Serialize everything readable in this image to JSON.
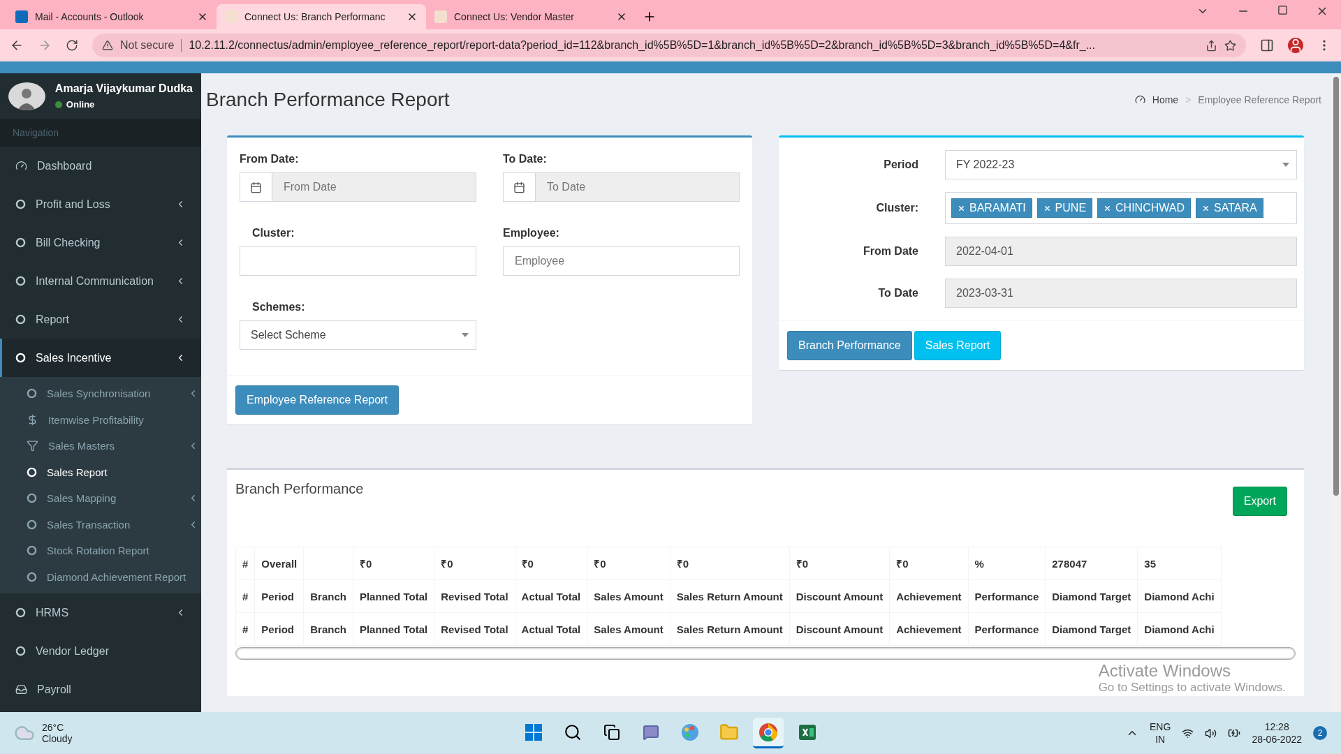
{
  "browser": {
    "tabs": [
      {
        "title": "Mail - Accounts - Outlook",
        "kind": "outlook",
        "selected": false
      },
      {
        "title": "Connect Us: Branch Performanc",
        "kind": "site",
        "selected": true
      },
      {
        "title": "Connect Us: Vendor Master",
        "kind": "site",
        "selected": false
      }
    ],
    "security": "Not secure",
    "url": "10.2.11.2/connectus/admin/employee_reference_report/report-data?period_id=112&branch_id%5B%5D=1&branch_id%5B%5D=2&branch_id%5B%5D=3&branch_id%5B%5D=4&fr_..."
  },
  "sidebar": {
    "user": {
      "name": "Amarja Vijaykumar Dudka",
      "status": "Online"
    },
    "section": "Navigation",
    "items": [
      {
        "label": "Dashboard",
        "kind": "dashboard",
        "expandable": false,
        "selected": false
      },
      {
        "label": "Profit and Loss",
        "kind": "circle",
        "expandable": true,
        "selected": false
      },
      {
        "label": "Bill Checking",
        "kind": "circle",
        "expandable": true,
        "selected": false
      },
      {
        "label": "Internal Communication",
        "kind": "circle",
        "expandable": true,
        "selected": false
      },
      {
        "label": "Report",
        "kind": "circle",
        "expandable": true,
        "selected": false
      },
      {
        "label": "Sales Incentive",
        "kind": "circle",
        "expandable": true,
        "selected": true,
        "children": [
          {
            "label": "Sales Synchronisation",
            "kind": "circle",
            "expandable": true,
            "selected": false
          },
          {
            "label": "Itemwise Profitability",
            "kind": "dollar",
            "expandable": false,
            "selected": false
          },
          {
            "label": "Sales Masters",
            "kind": "filter",
            "expandable": true,
            "selected": false
          },
          {
            "label": "Sales Report",
            "kind": "circle",
            "expandable": false,
            "selected": true
          },
          {
            "label": "Sales Mapping",
            "kind": "circle",
            "expandable": true,
            "selected": false
          },
          {
            "label": "Sales Transaction",
            "kind": "circle",
            "expandable": true,
            "selected": false
          },
          {
            "label": "Stock Rotation Report",
            "kind": "circle",
            "expandable": false,
            "selected": false
          },
          {
            "label": "Diamond Achievement Report",
            "kind": "circle",
            "expandable": false,
            "selected": false
          }
        ]
      },
      {
        "label": "HRMS",
        "kind": "circle",
        "expandable": true,
        "selected": false
      },
      {
        "label": "Vendor Ledger",
        "kind": "circle",
        "expandable": false,
        "selected": false
      },
      {
        "label": "Payroll",
        "kind": "inbox",
        "expandable": false,
        "selected": false
      }
    ]
  },
  "page": {
    "title": "Branch Performance Report",
    "breadcrumb": [
      "Home",
      "Employee Reference Report"
    ],
    "breadcrumb_separator": ">"
  },
  "filter_form": {
    "from_date": {
      "label": "From Date:",
      "placeholder": "From Date"
    },
    "to_date": {
      "label": "To Date:",
      "placeholder": "To Date"
    },
    "cluster": {
      "label": "Cluster:"
    },
    "employee": {
      "label": "Employee:",
      "placeholder": "Employee"
    },
    "schemes": {
      "label": "Schemes:",
      "value": "Select Scheme"
    },
    "button": "Employee Reference Report"
  },
  "report_form": {
    "period": {
      "label": "Period",
      "value": "FY 2022-23"
    },
    "cluster": {
      "label": "Cluster:",
      "tags": [
        "BARAMATI",
        "PUNE",
        "CHINCHWAD",
        "SATARA"
      ]
    },
    "from_date": {
      "label": "From Date",
      "value": "2022-04-01"
    },
    "to_date": {
      "label": "To Date",
      "value": "2023-03-31"
    },
    "buttons": [
      {
        "label": "Branch Performance",
        "kind": "primary"
      },
      {
        "label": "Sales Report",
        "kind": "info"
      }
    ]
  },
  "table_card": {
    "title": "Branch Performance",
    "export": "Export",
    "rows": [
      [
        "#",
        "Overall",
        null,
        "₹0",
        "₹0",
        "₹0",
        "₹0",
        "₹0",
        "₹0",
        "₹0",
        "%",
        "278047",
        "35"
      ],
      [
        "#",
        "Period",
        "Branch",
        "Planned Total",
        "Revised Total",
        "Actual Total",
        "Sales Amount",
        "Sales Return Amount",
        "Discount Amount",
        "Achievement",
        "Performance",
        "Diamond Target",
        "Diamond Achi"
      ],
      [
        "#",
        "Period",
        "Branch",
        "Planned Total",
        "Revised Total",
        "Actual Total",
        "Sales Amount",
        "Sales Return Amount",
        "Discount Amount",
        "Achievement",
        "Performance",
        "Diamond Target",
        "Diamond Achi"
      ]
    ]
  },
  "activation_notice": {
    "title": "Activate Windows",
    "text": "Go to Settings to activate Windows."
  },
  "taskbar": {
    "weather": {
      "temp": "26°C",
      "condition": "Cloudy"
    },
    "apps": [
      {
        "kind": "start",
        "selected": false
      },
      {
        "kind": "search",
        "selected": false
      },
      {
        "kind": "taskview",
        "selected": false
      },
      {
        "kind": "chat",
        "selected": false
      },
      {
        "kind": "paint",
        "selected": false
      },
      {
        "kind": "folder",
        "selected": false
      },
      {
        "kind": "chrome",
        "selected": true
      },
      {
        "kind": "excel",
        "selected": false
      }
    ],
    "language": [
      "ENG",
      "IN"
    ],
    "time": "12:28",
    "date": "28-06-2022",
    "notifications": "2"
  }
}
